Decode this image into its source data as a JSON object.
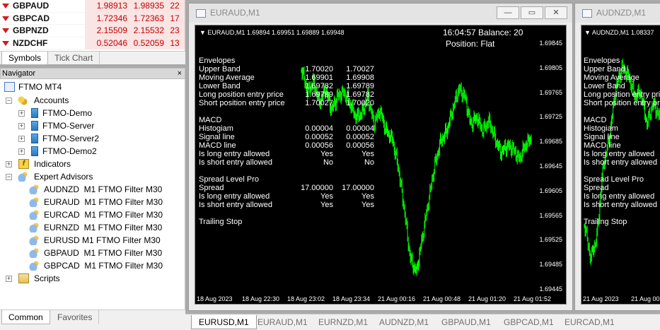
{
  "market_watch": {
    "rows": [
      {
        "symbol": "GBPAUD",
        "bid": "1.98913",
        "ask": "1.98935",
        "spread": "22",
        "dir": "down"
      },
      {
        "symbol": "GBPCAD",
        "bid": "1.72346",
        "ask": "1.72363",
        "spread": "17",
        "dir": "down"
      },
      {
        "symbol": "GBPNZD",
        "bid": "2.15509",
        "ask": "2.15532",
        "spread": "23",
        "dir": "down"
      },
      {
        "symbol": "NZDCHF",
        "bid": "0.52046",
        "ask": "0.52059",
        "spread": "13",
        "dir": "down"
      }
    ],
    "tabs": [
      "Symbols",
      "Tick Chart"
    ]
  },
  "navigator": {
    "title": "Navigator",
    "close": "×",
    "root": "FTMO MT4",
    "accounts": {
      "label": "Accounts",
      "items": [
        "FTMO-Demo",
        "FTMO-Server",
        "FTMO-Server2",
        "FTMO-Demo2"
      ]
    },
    "indicators": "Indicators",
    "experts": {
      "label": "Expert Advisors",
      "items": [
        "AUDNZD  M1 FTMO Filter M30",
        "EURAUD  M1 FTMO Filter M30",
        "EURCAD  M1 FTMO Filter M30",
        "EURNZD  M1 FTMO Filter M30",
        "EURUSD M1 FTMO Filter M30",
        "GBPAUD  M1 FTMO Filter M30",
        "GBPCAD  M1 FTMO Filter M30"
      ]
    },
    "scripts": "Scripts",
    "tabs": [
      "Common",
      "Favorites"
    ]
  },
  "chart1": {
    "window_title": "EURAUD,M1",
    "buttons": {
      "minimize": "—",
      "restore": "▭",
      "close": "✕"
    },
    "header": "▼ EURAUD,M1  1.69894 1.69951 1.69889 1.69948",
    "balance": "16:04:57 Balance: 20",
    "position": "Position: Flat",
    "indicators": [
      {
        "label": "Envelopes",
        "v1": "",
        "v2": ""
      },
      {
        "label": "Upper Band",
        "v1": "1.70020",
        "v2": "1.70027"
      },
      {
        "label": "Moving Average",
        "v1": "1.69901",
        "v2": "1.69908"
      },
      {
        "label": "Lower Band",
        "v1": "1.69782",
        "v2": "1.69789"
      },
      {
        "label": "Long position entry price",
        "v1": "1.69789",
        "v2": "1.69782"
      },
      {
        "label": "Short position entry price",
        "v1": "1.70027",
        "v2": "1.70020"
      },
      {
        "label": "",
        "v1": "",
        "v2": ""
      },
      {
        "label": "MACD",
        "v1": "",
        "v2": ""
      },
      {
        "label": "Histogiam",
        "v1": "0.00004",
        "v2": "0.00004"
      },
      {
        "label": "Signal line",
        "v1": "0.00052",
        "v2": "0.00052"
      },
      {
        "label": "MACD line",
        "v1": "0.00056",
        "v2": "0.00056"
      },
      {
        "label": "Is long entry allowed",
        "v1": "Yes",
        "v2": "Yes"
      },
      {
        "label": "Is short entry allowed",
        "v1": "No",
        "v2": "No"
      },
      {
        "label": "",
        "v1": "",
        "v2": ""
      },
      {
        "label": "Spread Level Pro",
        "v1": "",
        "v2": ""
      },
      {
        "label": "Spread",
        "v1": "17.00000",
        "v2": "17.00000"
      },
      {
        "label": "Is long entry allowed",
        "v1": "Yes",
        "v2": "Yes"
      },
      {
        "label": "Is short entry allowed",
        "v1": "Yes",
        "v2": "Yes"
      },
      {
        "label": "",
        "v1": "",
        "v2": ""
      },
      {
        "label": "Trailing Stop",
        "v1": "",
        "v2": ""
      }
    ],
    "y_ticks": [
      "1.69845",
      "1.69805",
      "1.69765",
      "1.69725",
      "1.69685",
      "1.69645",
      "1.69605",
      "1.69565",
      "1.69525",
      "1.69485",
      "1.69445"
    ],
    "x_ticks": [
      "18 Aug 2023",
      "18 Aug 22:30",
      "18 Aug 23:02",
      "18 Aug 23:34",
      "21 Aug 00:16",
      "21 Aug 00:48",
      "21 Aug 01:20",
      "21 Aug 01:52"
    ],
    "candle_color": "#00ff00"
  },
  "chart2": {
    "window_title": "AUDNZD,M1",
    "header": "▼ AUDNZD,M1  1.08337",
    "indicators": [
      "Envelopes",
      "Upper Band",
      "Moving Average",
      "Lower Band",
      "Long position entry pric",
      "Short position entry pric",
      "",
      "MACD",
      "Histogiam",
      "Signal line",
      "MACD line",
      "Is long entry allowed",
      "Is short entry allowed",
      "",
      "Spread Level Pro",
      "Spread",
      "Is long entry allowed",
      "Is short entry allowed",
      "",
      "Trailing Stop"
    ],
    "x_ticks": [
      "21 Aug 2023",
      "21 Aug 00:"
    ]
  },
  "chart_tabs": [
    "EURUSD,M1",
    "EURAUD,M1",
    "EURNZD,M1",
    "AUDNZD,M1",
    "GBPAUD,M1",
    "GBPCAD,M1",
    "EURCAD,M1"
  ]
}
